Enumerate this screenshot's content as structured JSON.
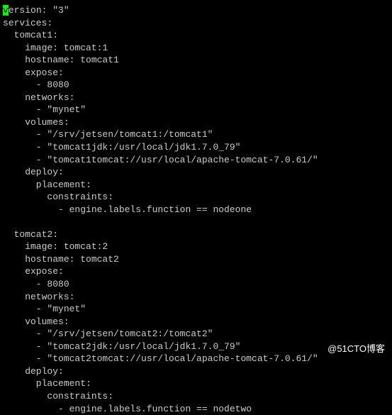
{
  "yaml": {
    "line1_char": "v",
    "line1_rest": "ersion: \"3\"",
    "line2": "services:",
    "tomcat1": {
      "header": "  tomcat1:",
      "image": "    image: tomcat:1",
      "hostname": "    hostname: tomcat1",
      "expose": "    expose:",
      "expose_item": "      - 8080",
      "networks": "    networks:",
      "networks_item": "      - \"mynet\"",
      "volumes": "    volumes:",
      "vol1": "      - \"/srv/jetsen/tomcat1:/tomcat1\"",
      "vol2": "      - \"tomcat1jdk:/usr/local/jdk1.7.0_79\"",
      "vol3": "      - \"tomcat1tomcat://usr/local/apache-tomcat-7.0.61/\"",
      "deploy": "    deploy:",
      "placement": "      placement:",
      "constraints": "        constraints:",
      "constraint_item": "          - engine.labels.function == nodeone"
    },
    "tomcat2": {
      "header": "  tomcat2:",
      "image": "    image: tomcat:2",
      "hostname": "    hostname: tomcat2",
      "expose": "    expose:",
      "expose_item": "      - 8080",
      "networks": "    networks:",
      "networks_item": "      - \"mynet\"",
      "volumes": "    volumes:",
      "vol1": "      - \"/srv/jetsen/tomcat2:/tomcat2\"",
      "vol2": "      - \"tomcat2jdk:/usr/local/jdk1.7.0_79\"",
      "vol3": "      - \"tomcat2tomcat://usr/local/apache-tomcat-7.0.61/\"",
      "deploy": "    deploy:",
      "placement": "      placement:",
      "constraints": "        constraints:",
      "constraint_item": "          - engine.labels.function == nodetwo"
    }
  },
  "watermark": "@51CTO博客"
}
